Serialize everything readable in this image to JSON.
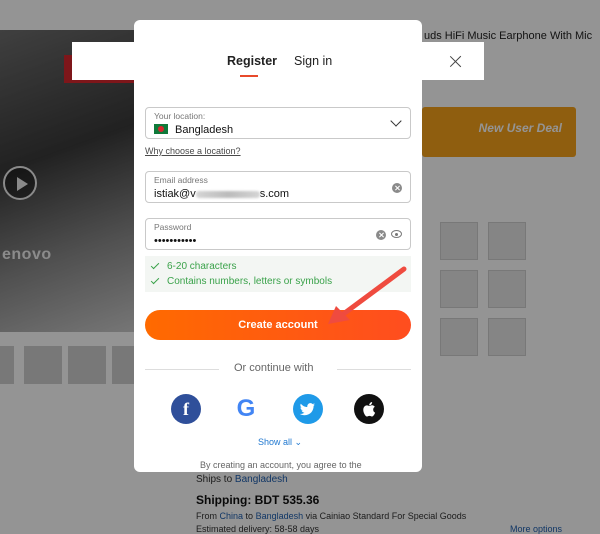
{
  "background": {
    "product_title": "uds HiFi Music Earphone With Mic",
    "brand_text": "enovo",
    "promo": "New User Deal",
    "ships_to_label": "Ships to",
    "ships_to_value": "Bangladesh",
    "shipping": "Shipping: BDT 535.36",
    "from_text_1": "From",
    "from_country": "China",
    "from_text_2": "to",
    "to_country": "Bangladesh",
    "from_text_3": "via Cainiao Standard For Special Goods",
    "delivery": "Estimated delivery: 58-58 days",
    "more_options": "More options"
  },
  "modal": {
    "tabs": [
      {
        "label": "Register",
        "active": true
      },
      {
        "label": "Sign in",
        "active": false
      }
    ],
    "location": {
      "label": "Your location:",
      "value": "Bangladesh"
    },
    "why_link": "Why choose a location?",
    "email": {
      "label": "Email address",
      "value_prefix": "istiak@v",
      "value_suffix": "s.com"
    },
    "password": {
      "label": "Password",
      "value": "•••••••••••"
    },
    "rules": [
      "6-20 characters",
      "Contains numbers, letters or symbols"
    ],
    "create_button": "Create account",
    "divider_text": "Or continue with",
    "social": [
      {
        "name": "facebook",
        "glyph": "f"
      },
      {
        "name": "google",
        "glyph": "G"
      },
      {
        "name": "twitter",
        "glyph": ""
      },
      {
        "name": "apple",
        "glyph": ""
      }
    ],
    "show_all": "Show all",
    "terms": "By creating an account, you agree to the"
  },
  "colors": {
    "accent": "#ff5a12",
    "rule_green": "#3aa24a",
    "link_blue": "#2078d0",
    "arrow": "#ef4b3f"
  }
}
